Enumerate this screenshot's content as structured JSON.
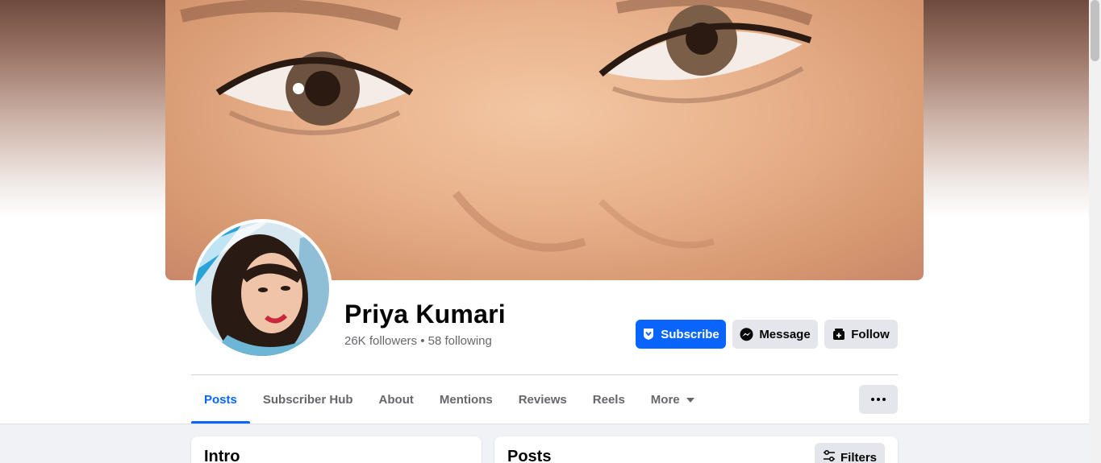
{
  "profile": {
    "name": "Priya Kumari",
    "followers": "26K followers",
    "separator": " • ",
    "following": "58 following"
  },
  "actions": {
    "subscribe": "Subscribe",
    "message": "Message",
    "follow": "Follow"
  },
  "tabs": [
    {
      "label": "Posts",
      "active": true
    },
    {
      "label": "Subscriber Hub"
    },
    {
      "label": "About"
    },
    {
      "label": "Mentions"
    },
    {
      "label": "Reviews"
    },
    {
      "label": "Reels"
    },
    {
      "label": "More",
      "icon": "caret-down-icon"
    }
  ],
  "sections": {
    "intro_title": "Intro",
    "posts_title": "Posts",
    "filters_label": "Filters"
  },
  "colors": {
    "accent": "#0866ff",
    "secondary_button": "#e4e6eb",
    "muted_text": "#65676b",
    "feed_background": "#f0f2f5"
  },
  "icons": {
    "subscribe": "subscribe-badge-icon",
    "message": "messenger-icon",
    "follow": "follow-icon",
    "more_options": "ellipsis-icon",
    "filters": "filter-sliders-icon"
  }
}
